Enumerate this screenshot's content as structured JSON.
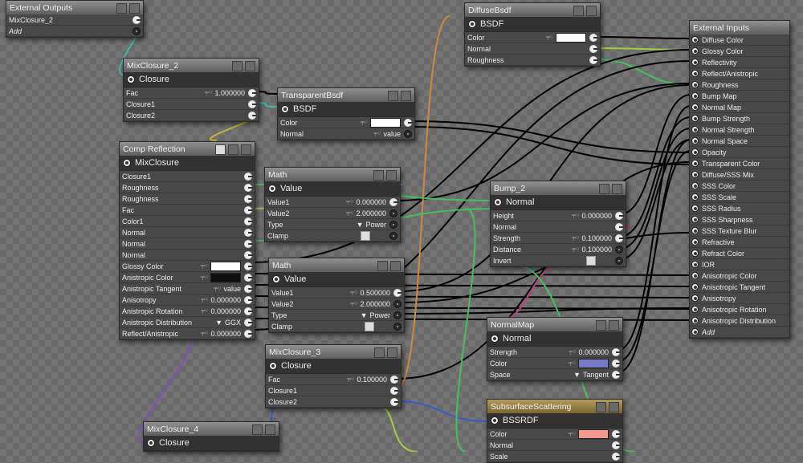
{
  "wire_colors": {
    "default": "#000000",
    "green": "#44c060",
    "lime": "#a0d040",
    "orange": "#d08840",
    "purple": "#8050c0",
    "blue": "#3a5ac8",
    "pink": "#c04080",
    "yellow": "#c8b830",
    "teal": "#40b8a0"
  },
  "nodes": [
    {
      "id": "external-outputs",
      "title": "External Outputs",
      "rows": [
        {
          "label": "MixClosure_2",
          "socket": "on"
        },
        {
          "label": "Add",
          "socket": "off",
          "italic": true
        }
      ]
    },
    {
      "id": "mixclosure-2",
      "title": "MixClosure_2",
      "output": "Closure",
      "rows": [
        {
          "label": "Fac",
          "value": "1.000000",
          "key": true,
          "socket": "on"
        },
        {
          "label": "Closure1",
          "socket": "on"
        },
        {
          "label": "Closure2",
          "socket": "on"
        }
      ]
    },
    {
      "id": "transparent-bsdf",
      "title": "TransparentBsdf",
      "output": "BSDF",
      "rows": [
        {
          "label": "Color",
          "color": "#ffffff",
          "key": true,
          "socket": "on"
        },
        {
          "label": "Normal",
          "value": "value",
          "key": true,
          "socket": "off"
        }
      ]
    },
    {
      "id": "comp-reflection",
      "title": "Comp Reflection",
      "output": "MixClosure",
      "extra_button": true,
      "rows": [
        {
          "label": "Closure1",
          "socket": "on"
        },
        {
          "label": "Roughness",
          "socket": "on"
        },
        {
          "label": "Roughness",
          "socket": "on"
        },
        {
          "label": "Fac",
          "socket": "on"
        },
        {
          "label": "Color1",
          "socket": "on"
        },
        {
          "label": "Normal",
          "socket": "on"
        },
        {
          "label": "Normal",
          "socket": "on"
        },
        {
          "label": "Normal",
          "socket": "on"
        },
        {
          "label": "Glossy Color",
          "color": "#ffffff",
          "key": true,
          "socket": "on"
        },
        {
          "label": "Anistropic Color",
          "color": "#111111",
          "key": true,
          "socket": "on"
        },
        {
          "label": "Anistropic Tangent",
          "value": "value",
          "key": true,
          "socket": "on"
        },
        {
          "label": "Anisotropy",
          "value": "0.000000",
          "key": true,
          "socket": "on"
        },
        {
          "label": "Anistropic Rotation",
          "value": "0.000000",
          "key": true,
          "socket": "on"
        },
        {
          "label": "Anistropic Distribution",
          "dropdown": "GGX",
          "socket": "on"
        },
        {
          "label": "Reflect/Anistropic",
          "value": "0.000000",
          "key": true,
          "socket": "on"
        }
      ]
    },
    {
      "id": "math-1",
      "title": "Math",
      "output": "Value",
      "rows": [
        {
          "label": "Value1",
          "value": "0.000000",
          "key": true,
          "socket": "on"
        },
        {
          "label": "Value2",
          "value": "2.000000",
          "key": true,
          "socket": "off"
        },
        {
          "label": "Type",
          "dropdown": "Power",
          "socket": "off"
        },
        {
          "label": "Clamp",
          "checkbox": false,
          "socket": "off"
        }
      ]
    },
    {
      "id": "math-2",
      "title": "Math",
      "output": "Value",
      "rows": [
        {
          "label": "Value1",
          "value": "0.500000",
          "key": true,
          "socket": "on"
        },
        {
          "label": "Value2",
          "value": "2.000000",
          "key": true,
          "socket": "off"
        },
        {
          "label": "Type",
          "dropdown": "Power",
          "socket": "off"
        },
        {
          "label": "Clamp",
          "checkbox": false,
          "socket": "off"
        }
      ]
    },
    {
      "id": "diffuse-bsdf",
      "title": "DiffuseBsdf",
      "output": "BSDF",
      "rows": [
        {
          "label": "Color",
          "color": "#ffffff",
          "key": true,
          "socket": "on"
        },
        {
          "label": "Normal",
          "socket": "on"
        },
        {
          "label": "Roughness",
          "socket": "on"
        }
      ]
    },
    {
      "id": "bump-2",
      "title": "Bump_2",
      "output": "Normal",
      "rows": [
        {
          "label": "Height",
          "value": "0.000000",
          "key": true,
          "socket": "on"
        },
        {
          "label": "Normal",
          "socket": "on"
        },
        {
          "label": "Strength",
          "value": "0.100000",
          "key": true,
          "socket": "on"
        },
        {
          "label": "Distance",
          "value": "0.100000",
          "key": true,
          "socket": "off"
        },
        {
          "label": "Invert",
          "checkbox": false,
          "socket": "off"
        }
      ]
    },
    {
      "id": "normal-map",
      "title": "NormalMap",
      "output": "Normal",
      "rows": [
        {
          "label": "Strength",
          "value": "0.000000",
          "key": true,
          "socket": "on"
        },
        {
          "label": "Color",
          "color": "#7878c8",
          "key": true,
          "socket": "on"
        },
        {
          "label": "Space",
          "dropdown": "Tangent",
          "socket": "on"
        }
      ]
    },
    {
      "id": "subsurface-scattering",
      "title": "SubsurfaceScattering",
      "output": "BSSRDF",
      "rows": [
        {
          "label": "Color",
          "color": "#f09890",
          "key": true,
          "socket": "on"
        },
        {
          "label": "Normal",
          "socket": "on"
        },
        {
          "label": "Scale",
          "socket": "on"
        }
      ]
    },
    {
      "id": "mixclosure-3",
      "title": "MixClosure_3",
      "output": "Closure",
      "rows": [
        {
          "label": "Fac",
          "value": "0.100000",
          "key": true,
          "socket": "on"
        },
        {
          "label": "Closure1",
          "socket": "on"
        },
        {
          "label": "Closure2",
          "socket": "on"
        }
      ]
    },
    {
      "id": "mixclosure-4",
      "title": "MixClosure_4",
      "output": "Closure",
      "rows": []
    }
  ],
  "external_inputs": {
    "title": "External Inputs",
    "items": [
      "Diffuse Color",
      "Glossy Color",
      "Reflectivity",
      "Reflect/Anistropic",
      "Roughness",
      "Bump Map",
      "Normal Map",
      "Bump Strength",
      "Normal Strength",
      "Normal Space",
      "Opacity",
      "Transparent Color",
      "Diffuse/SSS Mix",
      "SSS Color",
      "SSS Scale",
      "SSS Radius",
      "SSS Sharpness",
      "SSS Texture Blur",
      "Refractive",
      "Refract Color",
      "IOR",
      "Anisotropic Color",
      "Anisotropic Tangent",
      "Anisotropy",
      "Anisotropic Rotation",
      "Anisotropic Distribution"
    ],
    "add_label": "Add"
  }
}
